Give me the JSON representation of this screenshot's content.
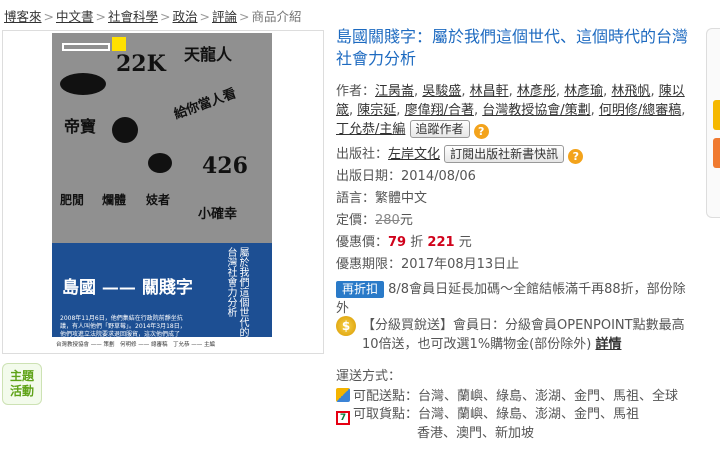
{
  "breadcrumb": {
    "items": [
      "博客來",
      "中文書",
      "社會科學",
      "政治",
      "評論"
    ],
    "current": "商品介紹",
    "separator": ">"
  },
  "cover": {
    "title": "島國 —— 關賤字",
    "vertical_subtitle": "屬於我們這個世代的台灣社會力分析",
    "words": {
      "k22": "22K",
      "tianlong": "天龍人",
      "di_bao": "帝寶",
      "kan": "給你當人看",
      "n426": "426",
      "fei_jian": "肥閒",
      "qiang_ti": "爛體",
      "ji_zhe": "妓者",
      "xiao_que": "小確幸"
    },
    "paragraph": "2008年11月6日，他們集結在行政院前靜坐抗議，有人叫他們「野草莓」。2014年3月18日，他們攻進立法院要求退回服貿，這次他們成了「太陽花」。",
    "footer": "台灣教授協會 —— 策劃　何明修 —— 總審稿　丁允恭 —— 主編"
  },
  "theme_button": {
    "line1": "主題",
    "line2": "活動"
  },
  "product": {
    "title": "島國關賤字：屬於我們這個世代、這個時代的台灣社會力分析",
    "author_label": "作者：",
    "authors": [
      "江昺崙",
      "吳駿盛",
      "林昌軒",
      "林彥彤",
      "林彥瑜",
      "林飛帆",
      "陳以箴",
      "陳宗延",
      "廖偉翔/合著",
      "台灣教授協會/策劃",
      "何明修/總審稿",
      "丁允恭/主編"
    ],
    "follow_author_label": "追蹤作者",
    "publisher_label": "出版社：",
    "publisher": "左岸文化",
    "subscribe_label": "訂閱出版社新書快訊",
    "date_label": "出版日期：",
    "date": "2014/08/06",
    "language_label": "語言：",
    "language": "繁體中文",
    "list_price_label": "定價：",
    "list_price": "280",
    "yuan": "元",
    "sale_label": "優惠價：",
    "discount": "79",
    "zhe": "折",
    "sale_price": "221",
    "period_label": "優惠期限：",
    "period": "2017年08月13日止",
    "repeat_badge": "再折扣",
    "repeat_text": "8/8會員日延長加碼～全館結帳滿千再88折，部份除外",
    "help_icon": "?"
  },
  "promo": {
    "coin_icon": "$",
    "text": "【分級買銳送】會員日：分級會員OPENPOINT點數最高10倍送，也可改選1%購物金(部份除外)",
    "detail_link": "詳情"
  },
  "delivery": {
    "title": "運送方式：",
    "ship_label": "可配送點：",
    "ship_areas": "台灣、蘭嶼、綠島、澎湖、金門、馬祖、全球",
    "pickup_label": "可取貨點：",
    "pickup_areas_line1": "台灣、蘭嶼、綠島、澎湖、金門、馬祖",
    "pickup_areas_line2": "香港、澳門、新加坡",
    "icon_711": "7"
  }
}
